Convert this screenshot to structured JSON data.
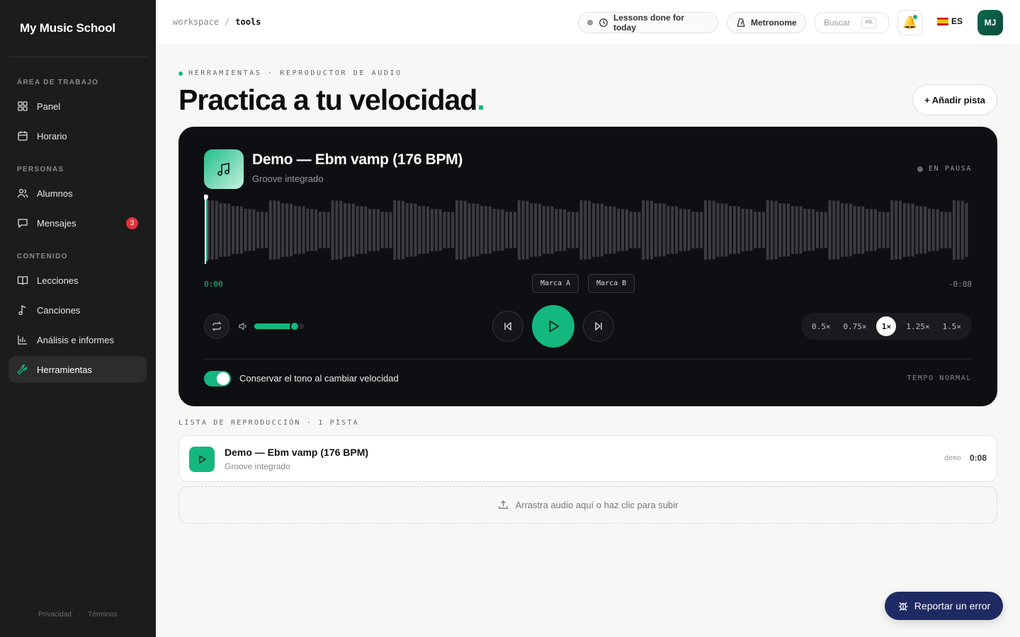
{
  "sidebar": {
    "brand": "My Music School",
    "sections": {
      "workspace": "ÁREA DE TRABAJO",
      "people": "PERSONAS",
      "content": "CONTENIDO"
    },
    "items": [
      {
        "label": "Panel",
        "icon": "dashboard-icon"
      },
      {
        "label": "Horario",
        "icon": "calendar-icon"
      },
      {
        "label": "Alumnos",
        "icon": "users-icon"
      },
      {
        "label": "Mensajes",
        "icon": "message-icon",
        "badge": "3"
      },
      {
        "label": "Lecciones",
        "icon": "book-icon"
      },
      {
        "label": "Canciones",
        "icon": "music-note-icon"
      },
      {
        "label": "Análisis e informes",
        "icon": "bar-chart-icon"
      },
      {
        "label": "Herramientas",
        "icon": "wrench-icon",
        "active": true
      }
    ],
    "footer": {
      "privacy": "Privacidad",
      "sep": "·",
      "terms": "Términos"
    }
  },
  "topbar": {
    "breadcrumb": {
      "root": "workspace",
      "sep": "/",
      "current": "tools"
    },
    "lessons_pill": "Lessons done for today",
    "metronome_pill": "Metronome",
    "search": {
      "placeholder": "Buscar",
      "shortcut": "⌘K"
    },
    "lang": "ES",
    "avatar_initials": "MJ"
  },
  "header": {
    "eyebrow": "HERRAMIENTAS · REPRODUCTOR DE AUDIO",
    "title": "Practica a tu velocidad",
    "title_accent": ".",
    "add_button": "+ Añadir pista"
  },
  "player": {
    "title": "Demo — Ebm vamp (176 BPM)",
    "subtitle": "Groove integrado",
    "status": "EN PAUSA",
    "time_current": "0:00",
    "time_remaining": "-0:08",
    "marker_a": "Marca A",
    "marker_b": "Marca B",
    "volume_level": 0.82,
    "speeds": [
      "0.5×",
      "0.75×",
      "1×",
      "1.25×",
      "1.5×"
    ],
    "selected_speed": "1×",
    "preserve_pitch_label": "Conservar el tono al cambiar velocidad",
    "preserve_pitch_on": true,
    "tempo_label": "TEMPO NORMAL"
  },
  "playlist": {
    "label": "LISTA DE REPRODUCCIÓN · 1 PISTA",
    "tracks": [
      {
        "title": "Demo — Ebm vamp (176 BPM)",
        "subtitle": "Groove integrado",
        "tag": "demo",
        "duration": "0:08"
      }
    ],
    "upload_label": "Arrastra audio aquí o haz clic para subir"
  },
  "report_button": "Reportar un error",
  "colors": {
    "accent": "#14b87e",
    "sidebar_bg": "#1c1c1c",
    "player_bg": "#0e0f12",
    "report_bg": "#1e2a63",
    "badge": "#e5303c"
  }
}
